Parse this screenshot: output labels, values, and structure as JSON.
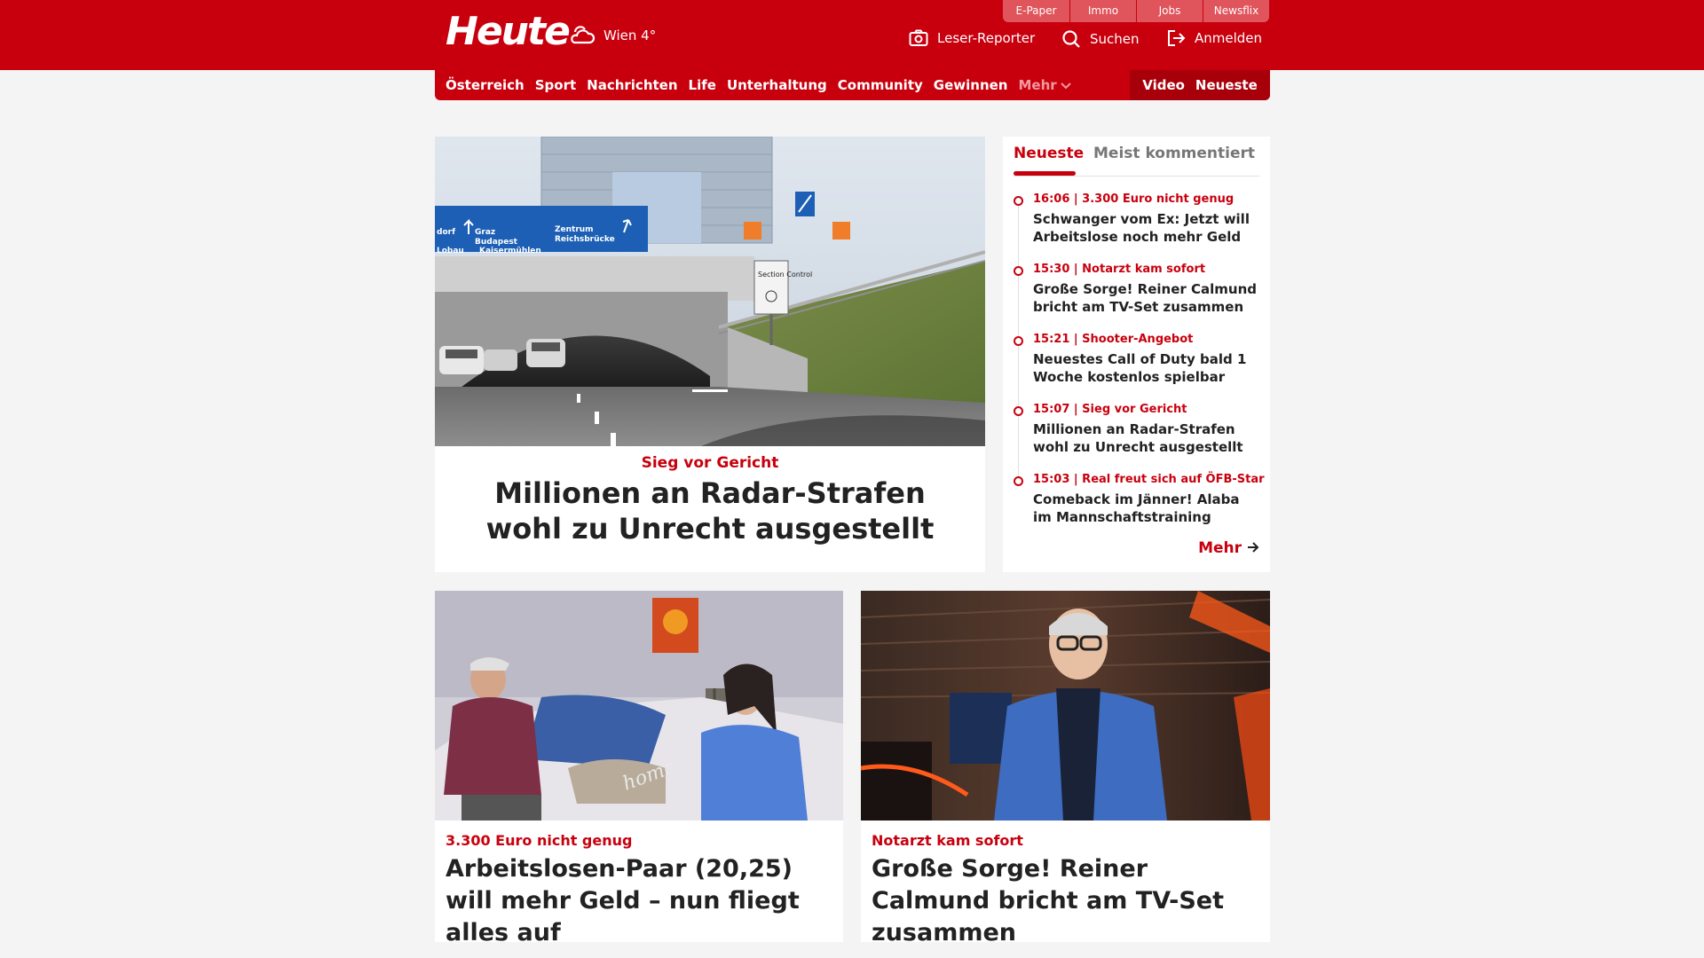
{
  "header": {
    "logo": "Heute",
    "weather": "Wien 4°",
    "top_links": [
      "E-Paper",
      "Immo",
      "Jobs",
      "Newsflix"
    ],
    "actions": {
      "reporter": "Leser-Reporter",
      "search": "Suchen",
      "login": "Anmelden"
    }
  },
  "nav": {
    "items": [
      "Österreich",
      "Sport",
      "Nachrichten",
      "Life",
      "Unterhaltung",
      "Community",
      "Gewinnen"
    ],
    "more": "Mehr",
    "video": "Video",
    "latest": "Neueste"
  },
  "hero": {
    "kicker": "Sieg vor Gericht",
    "title": "Millionen an Radar-Strafen wohl zu Unrecht ausgestellt",
    "image_text": {
      "sign_dir_left": "Graz",
      "sign_dir_left2": "Budapest",
      "sign_dir_left3": "Kaisermühlen",
      "sign_dir_left4": "Lobau",
      "sign_dir_left5": "dorf",
      "sign_dir_right": "Zentrum",
      "sign_dir_right2": "Reichsbrücke",
      "section_control": "Section Control"
    }
  },
  "sidebar": {
    "tab_latest": "Neueste",
    "tab_commented": "Meist kommentiert",
    "items": [
      {
        "meta": "16:06 | 3.300 Euro nicht genug",
        "headline": "Schwanger vom Ex: Jetzt will Arbeitslose noch mehr Geld"
      },
      {
        "meta": "15:30 | Notarzt kam sofort",
        "headline": "Große Sorge! Reiner Calmund bricht am TV-Set zusammen"
      },
      {
        "meta": "15:21 | Shooter-Angebot",
        "headline": "Neuestes Call of Duty bald 1 Woche kostenlos spielbar"
      },
      {
        "meta": "15:07 | Sieg vor Gericht",
        "headline": "Millionen an Radar-Strafen wohl zu Unrecht ausgestellt"
      },
      {
        "meta": "15:03 | Real freut sich auf ÖFB-Star",
        "headline": "Comeback im Jänner! Alaba im Mannschaftstraining"
      }
    ],
    "more": "Mehr"
  },
  "cards": [
    {
      "kicker": "3.300 Euro nicht genug",
      "title": "Arbeitslosen-Paar (20,25) will mehr Geld – nun fliegt alles auf",
      "image_text": "home"
    },
    {
      "kicker": "Notarzt kam sofort",
      "title": "Große Sorge! Reiner Calmund bricht am TV-Set zusammen"
    }
  ],
  "colors": {
    "brand_red": "#c8000e",
    "dark_red": "#a8000b",
    "top_link_bg": "#e0545b",
    "page_bg": "#f4f4f4"
  }
}
